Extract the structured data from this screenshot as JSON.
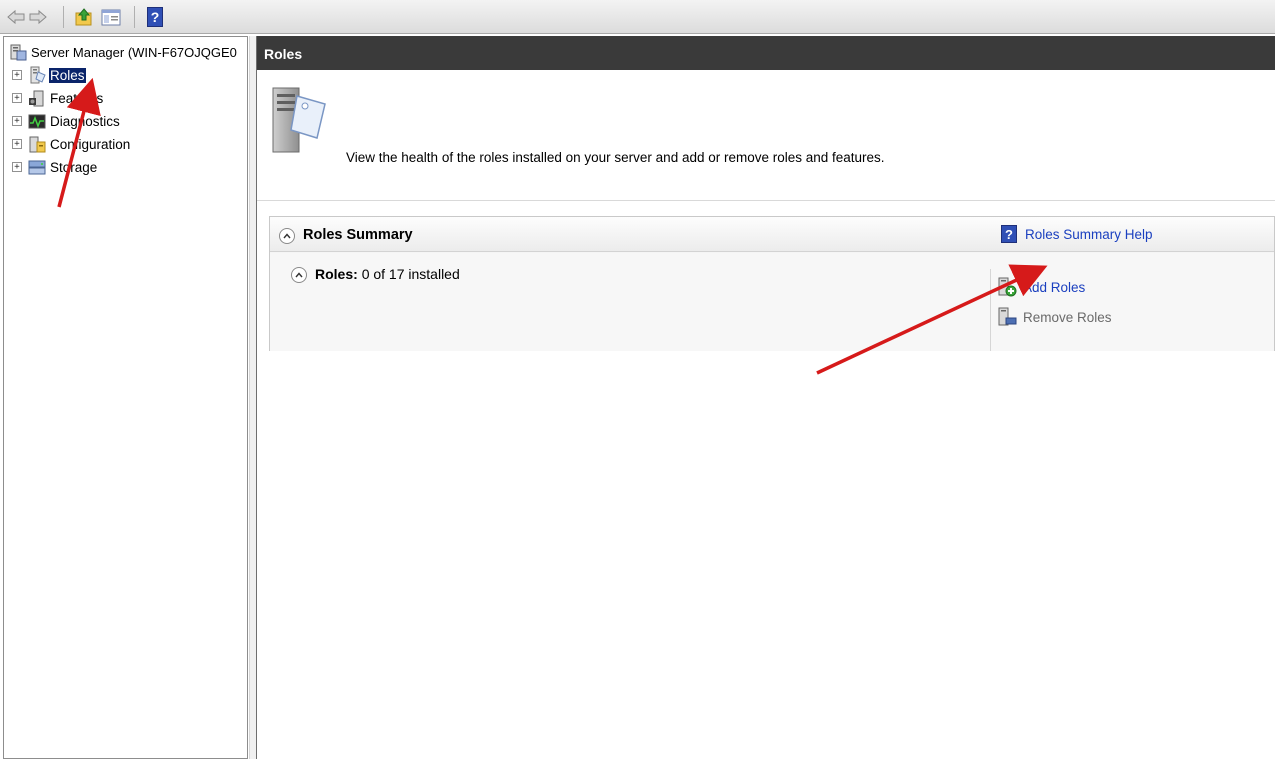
{
  "toolbar": {
    "buttons": [
      "back-icon",
      "forward-icon",
      "up-level-icon",
      "show-hide-tree-icon",
      "help-icon"
    ],
    "help_glyph": "?"
  },
  "tree": {
    "root_label": "Server Manager (WIN-F67OJQGE0",
    "items": [
      {
        "label": "Roles",
        "icon": "roles-icon",
        "selected": true
      },
      {
        "label": "Features",
        "icon": "features-icon",
        "selected": false
      },
      {
        "label": "Diagnostics",
        "icon": "diagnostics-icon",
        "selected": false
      },
      {
        "label": "Configuration",
        "icon": "configuration-icon",
        "selected": false
      },
      {
        "label": "Storage",
        "icon": "storage-icon",
        "selected": false
      }
    ],
    "expander_glyph": "+"
  },
  "pane": {
    "header_title": "Roles",
    "intro_text": "View the health of the roles installed on your server and add or remove roles and features.",
    "summary": {
      "title": "Roles Summary",
      "help_glyph": "?",
      "help_link": "Roles Summary Help",
      "roles_label": "Roles:",
      "roles_status": "0 of 17 installed",
      "tasks": {
        "add_roles": "Add Roles",
        "remove_roles": "Remove Roles"
      }
    }
  },
  "colors": {
    "header_bg": "#3a3a3a",
    "selection_bg": "#0a246a",
    "link": "#1a3fbf",
    "annotation_arrow": "#d61a1a"
  }
}
